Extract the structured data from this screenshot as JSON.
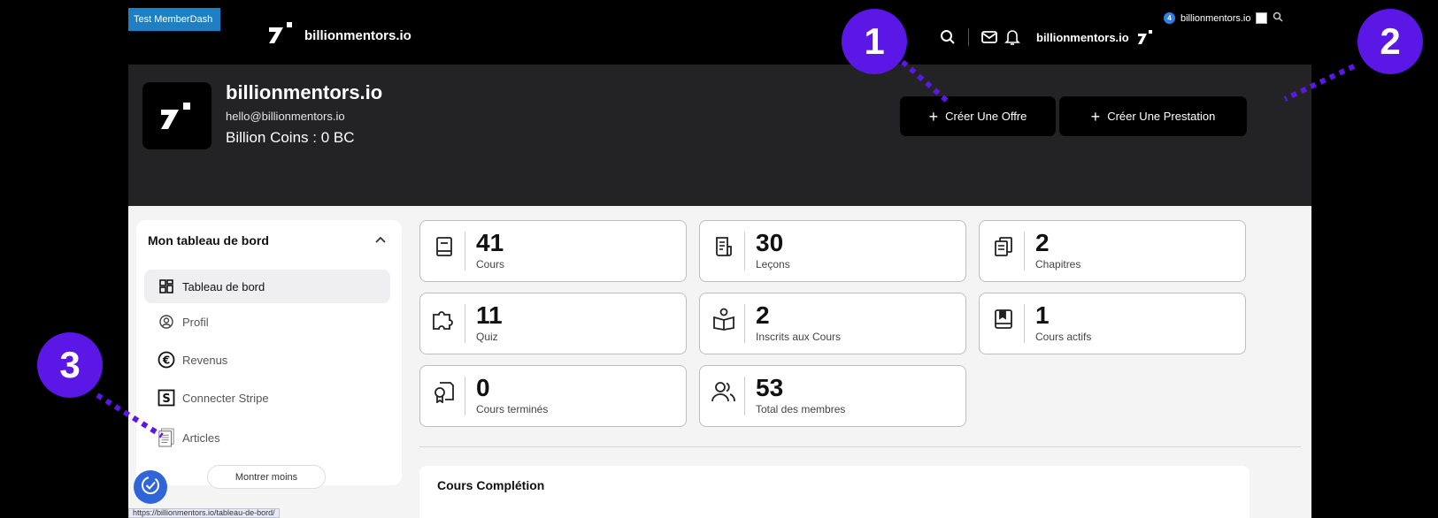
{
  "topbar": {
    "env_badge": "Test MemberDash",
    "brand": "billionmentors.io",
    "user": "billionmentors.io",
    "notification_count": "4",
    "wp_user": "billionmentors.io"
  },
  "header": {
    "name": "billionmentors.io",
    "email": "hello@billionmentors.io",
    "coins": "Billion Coins : 0 BC",
    "btn_offer": "Créer Une Offre",
    "btn_service": "Créer Une Prestation"
  },
  "sidebar": {
    "title": "Mon tableau de bord",
    "items": [
      {
        "label": "Tableau de bord",
        "icon": "dashboard-icon"
      },
      {
        "label": "Profil",
        "icon": "user-circle-icon"
      },
      {
        "label": "Revenus",
        "icon": "euro-icon"
      },
      {
        "label": "Connecter Stripe",
        "icon": "stripe-icon"
      },
      {
        "label": "Articles",
        "icon": "articles-icon"
      }
    ],
    "show_less": "Montrer moins"
  },
  "stats": [
    {
      "value": "41",
      "label": "Cours",
      "icon": "book-icon"
    },
    {
      "value": "30",
      "label": "Leçons",
      "icon": "lesson-icon"
    },
    {
      "value": "2",
      "label": "Chapitres",
      "icon": "chapters-icon"
    },
    {
      "value": "11",
      "label": "Quiz",
      "icon": "puzzle-icon"
    },
    {
      "value": "2",
      "label": "Inscrits aux Cours",
      "icon": "enrolled-icon"
    },
    {
      "value": "1",
      "label": "Cours actifs",
      "icon": "bookmark-icon"
    },
    {
      "value": "0",
      "label": "Cours terminés",
      "icon": "certificate-icon"
    },
    {
      "value": "53",
      "label": "Total des membres",
      "icon": "members-icon"
    }
  ],
  "completion_title": "Cours Complétion",
  "status_url": "https://billionmentors.io/tableau-de-bord/",
  "callouts": [
    "1",
    "2",
    "3"
  ],
  "colors": {
    "accent": "#5a17e6",
    "header_bg": "#232326",
    "topbar_bg": "#000000"
  }
}
